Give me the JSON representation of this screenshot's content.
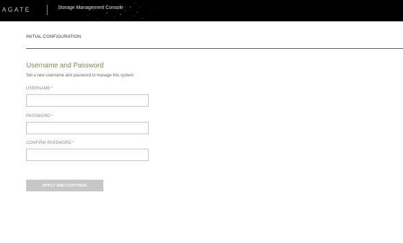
{
  "header": {
    "brand": "AGATE",
    "title": "Storage Management Console"
  },
  "section": {
    "title": "INITIAL CONFIGURATION"
  },
  "form": {
    "title": "Username and Password",
    "description": "Set a new username and password to manage this system",
    "required_marker": "*",
    "fields": [
      {
        "label": "USERNAME",
        "value": ""
      },
      {
        "label": "PASSWORD",
        "value": ""
      },
      {
        "label": "CONFIRM PASSWORD",
        "value": ""
      }
    ],
    "submit_label": "APPLY AND CONTINUE"
  },
  "colors": {
    "header_background": "#000000",
    "form_title": "#7a8a4a",
    "button_disabled": "#c7c7c7"
  }
}
